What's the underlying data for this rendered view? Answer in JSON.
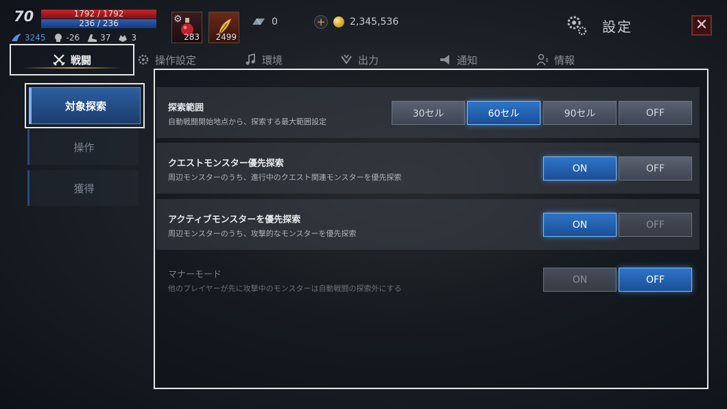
{
  "hud": {
    "level": "70",
    "hp": "1792 / 1792",
    "mp": "236 / 236",
    "stats": [
      "3245",
      "-26",
      "37",
      "3"
    ],
    "items": [
      {
        "count": "283"
      },
      {
        "count": "2499"
      }
    ],
    "gem": "0",
    "gold": "2,345,536"
  },
  "header": {
    "title": "設定",
    "close": "✕"
  },
  "tabs": [
    "戦闘",
    "操作設定",
    "環境",
    "出力",
    "通知",
    "情報"
  ],
  "subnav": [
    "対象探索",
    "操作",
    "獲得"
  ],
  "settings": [
    {
      "title": "探索範囲",
      "desc": "自動戦闘開始地点から、探索する最大範囲設定",
      "options": [
        "30セル",
        "60セル",
        "90セル",
        "OFF"
      ],
      "selected": "60セル"
    },
    {
      "title": "クエストモンスター優先探索",
      "desc": "周辺モンスターのうち、進行中のクエスト関連モンスターを優先探索",
      "options": [
        "ON",
        "OFF"
      ],
      "selected": "ON"
    },
    {
      "title": "アクティブモンスターを優先探索",
      "desc": "周辺モンスターのうち、攻撃的なモンスターを優先探索",
      "options": [
        "ON",
        "OFF"
      ],
      "selected": "ON"
    },
    {
      "title": "マナーモード",
      "desc": "他のプレイヤーが先に攻撃中のモンスターは自動戦闘の探索外にする",
      "options": [
        "ON",
        "OFF"
      ],
      "selected": "OFF"
    }
  ]
}
